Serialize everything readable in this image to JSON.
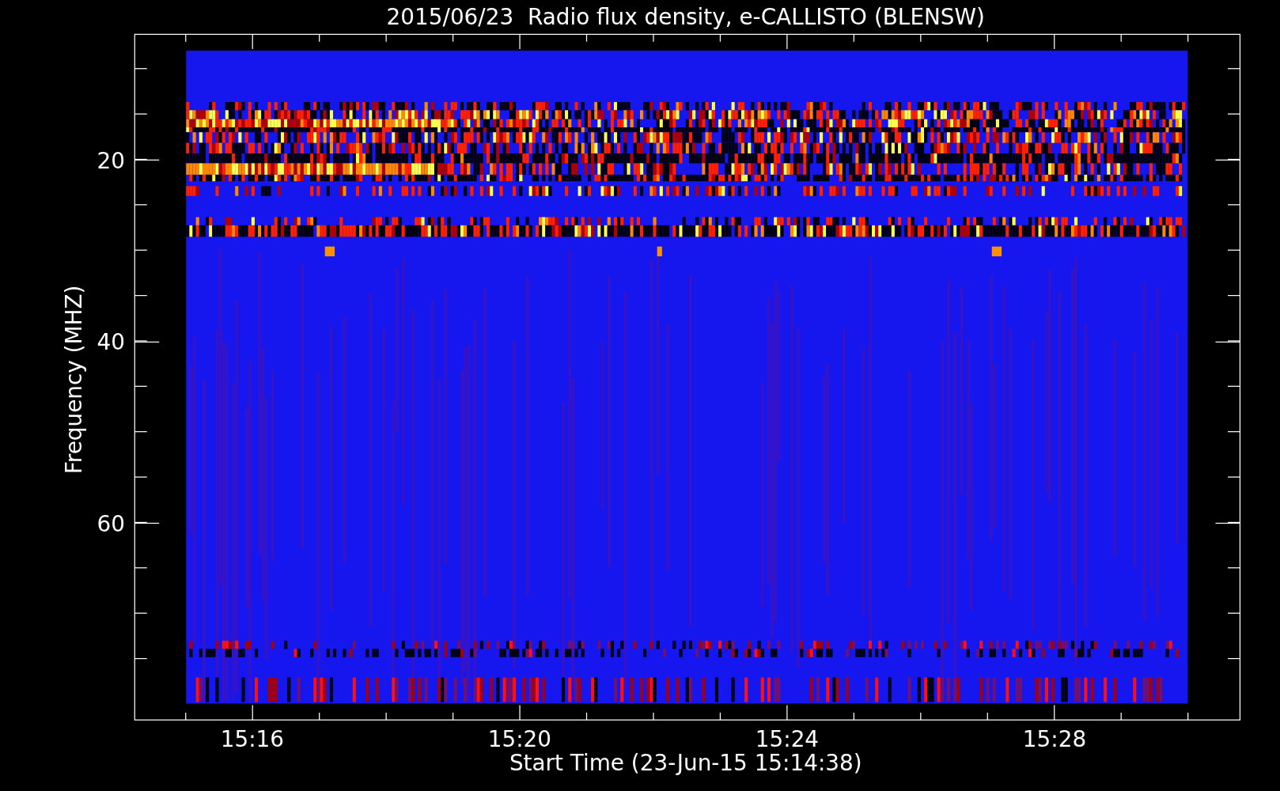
{
  "chart": {
    "title": "2015/06/23  Radio flux density, e-CALLISTO (BLENSW)",
    "y_axis": {
      "label": "Frequency (MHZ)",
      "ticks": [
        "20",
        "40",
        "60"
      ]
    },
    "x_axis": {
      "label": "Start Time (23-Jun-15 15:14:38)",
      "ticks": [
        "15:16",
        "15:20",
        "15:24",
        "15:28"
      ]
    }
  }
}
